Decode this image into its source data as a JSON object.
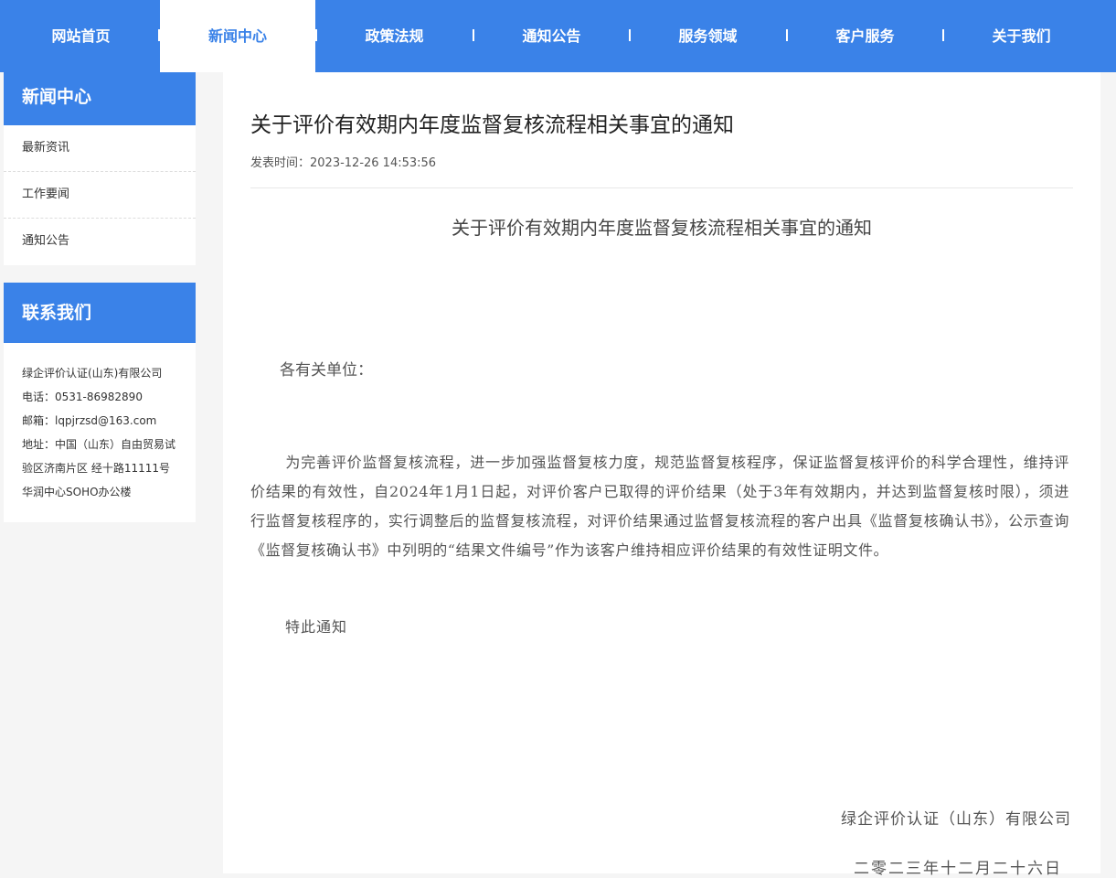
{
  "nav": {
    "items": [
      {
        "label": "网站首页"
      },
      {
        "label": "新闻中心"
      },
      {
        "label": "政策法规"
      },
      {
        "label": "通知公告"
      },
      {
        "label": "服务领域"
      },
      {
        "label": "客户服务"
      },
      {
        "label": "关于我们"
      }
    ],
    "active_label": "新闻中心"
  },
  "sidebar": {
    "news": {
      "title": "新闻中心",
      "links": [
        {
          "label": "最新资讯"
        },
        {
          "label": "工作要闻"
        },
        {
          "label": "通知公告"
        }
      ]
    },
    "contact": {
      "title": "联系我们",
      "lines": [
        "绿企评价认证(山东)有限公司",
        "电话：0531-86982890",
        "邮箱：lqpjrzsd@163.com",
        "地址：中国（山东）自由贸易试",
        "验区济南片区 经十路11111号",
        "华润中心SOHO办公楼"
      ]
    }
  },
  "article": {
    "title": "关于评价有效期内年度监督复核流程相关事宜的通知",
    "meta": "发表时间：2023-12-26 14:53:56",
    "doc_title": "关于评价有效期内年度监督复核流程相关事宜的通知",
    "greeting": "各有关单位：",
    "body": "为完善评价监督复核流程，进一步加强监督复核力度，规范监督复核程序，保证监督复核评价的科学合理性，维持评价结果的有效性，自2024年1月1日起，对评价客户已取得的评价结果（处于3年有效期内，并达到监督复核时限），须进行监督复核程序的，实行调整后的监督复核流程，对评价结果通过监督复核流程的客户出具《监督复核确认书》，公示查询《监督复核确认书》中列明的“结果文件编号”作为该客户维持相应评价结果的有效性证明文件。",
    "closing": "特此通知",
    "signature_org": "绿企评价认证（山东）有限公司",
    "signature_date": "二零二三年十二月二十六日"
  },
  "colors": {
    "primary": "#3a82e8",
    "background": "#f5f5f5",
    "text": "#333333"
  }
}
